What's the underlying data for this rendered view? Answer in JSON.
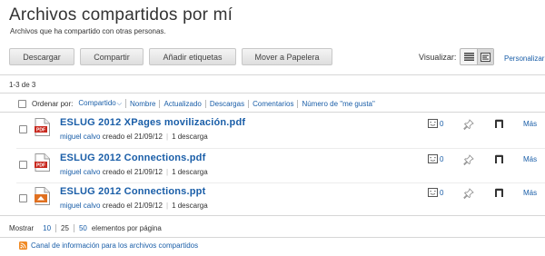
{
  "page": {
    "title": "Archivos compartidos por mí",
    "subtitle": "Archivos que ha compartido con otras personas."
  },
  "toolbar": {
    "download_label": "Descargar",
    "share_label": "Compartir",
    "add_tags_label": "Añadir etiquetas",
    "trash_label": "Mover a Papelera"
  },
  "view": {
    "label": "Visualizar:",
    "customize_label": "Personalizar",
    "modes": [
      "list-view-icon",
      "details-view-icon"
    ],
    "active_mode": "details-view-icon"
  },
  "list": {
    "count_text": "1-3 de 3",
    "sort_label": "Ordenar por:",
    "sort_options": [
      "Compartido",
      "Nombre",
      "Actualizado",
      "Descargas",
      "Comentarios",
      "Número de \"me gusta\""
    ],
    "active_sort": "Compartido"
  },
  "files": [
    {
      "name": "ESLUG 2012 XPages movilización.pdf",
      "icon": "pdf-file-icon",
      "owner": "miguel calvo",
      "created": "creado el 21/09/12",
      "downloads": "1 descarga",
      "comments": "0",
      "more_label": "Más"
    },
    {
      "name": "ESLUG 2012 Connections.pdf",
      "icon": "pdf-file-icon",
      "owner": "miguel calvo",
      "created": "creado el 21/09/12",
      "downloads": "1 descarga",
      "comments": "0",
      "more_label": "Más"
    },
    {
      "name": "ESLUG 2012 Connections.ppt",
      "icon": "ppt-file-icon",
      "owner": "miguel calvo",
      "created": "creado el 21/09/12",
      "downloads": "1 descarga",
      "comments": "0",
      "more_label": "Más"
    }
  ],
  "pager": {
    "show_label": "Mostrar",
    "options": [
      "10",
      "25",
      "50"
    ],
    "current": "25",
    "suffix": "elementos por página"
  },
  "feed": {
    "label": "Canal de información para los archivos compartidos"
  },
  "colors": {
    "link": "#1a5ea8",
    "pdf_red": "#c8281e",
    "ppt_orange": "#e07020"
  }
}
